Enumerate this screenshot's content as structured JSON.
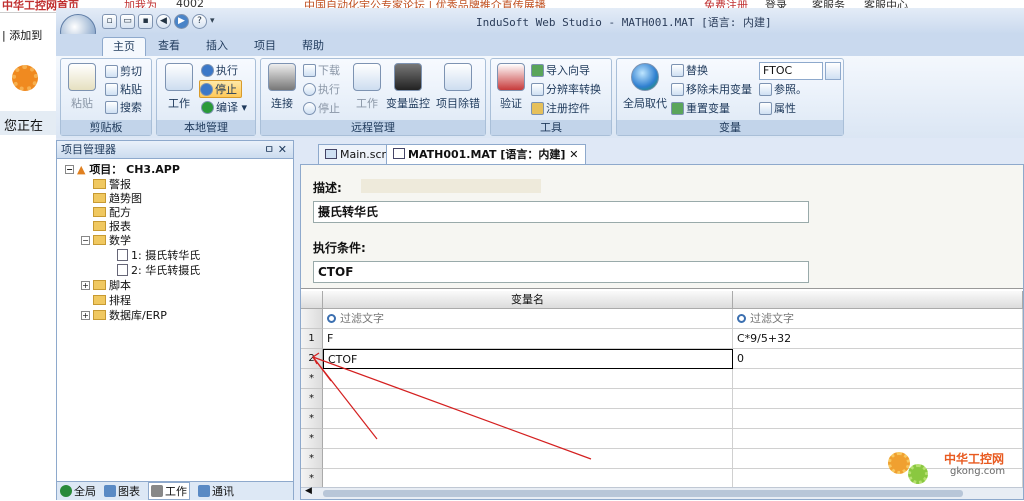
{
  "background": {
    "strip_texts": [
      "中华工控网首页",
      "加我为",
      "4002",
      "中国自动化宇公专家论坛 | 优秀品牌推介直传展播",
      "免费注册",
      "登录",
      "客服务",
      "客服中心"
    ],
    "left_texts": [
      "| 添加到",
      "您正在"
    ]
  },
  "window": {
    "title": "InduSoft Web Studio - MATH001.MAT [语言: 内建]",
    "quick_access": [
      "new",
      "open",
      "save",
      "back",
      "forward",
      "help"
    ]
  },
  "ribbon": {
    "tabs": [
      "主页",
      "查看",
      "插入",
      "项目",
      "帮助"
    ],
    "active_tab": "主页",
    "groups": {
      "clipboard": {
        "caption": "剪贴板",
        "paste": "粘贴",
        "cut": "剪切",
        "paste2": "粘贴",
        "search": "搜索"
      },
      "local": {
        "caption": "本地管理",
        "work": "工作",
        "run": "执行",
        "stop": "停止",
        "compile": "编译"
      },
      "remote": {
        "caption": "远程管理",
        "connect": "连接",
        "download": "下载",
        "run": "执行",
        "stop": "停止",
        "work": "工作",
        "monitor": "变量监控",
        "debug": "项目除错"
      },
      "tools": {
        "caption": "工具",
        "verify": "验证",
        "import": "导入向导",
        "resolution": "分辨率转换",
        "register": "注册控件"
      },
      "tags": {
        "caption": "变量",
        "global_replace": "全局取代",
        "replace": "替换",
        "remove_unused": "移除未用变量",
        "reset": "重置变量",
        "search_value": "FTOC",
        "refs": "参照。",
        "props": "属性"
      }
    }
  },
  "project_manager": {
    "title": "项目管理器",
    "controls": "ㅁ ✕",
    "root": "项目： CH3.APP",
    "items": [
      "警报",
      "趋势图",
      "配方",
      "报表",
      "数学",
      "1: 摄氏转华氏",
      "2: 华氏转摄氏",
      "脚本",
      "排程",
      "数据库/ERP"
    ],
    "footer_tabs": [
      "全局",
      "图表",
      "工作",
      "通讯"
    ]
  },
  "doc_tabs": {
    "tab1": "Main.scr",
    "tab2": "MATH001.MAT [语言：内建]",
    "close": "✕"
  },
  "form": {
    "desc_label": "描述:",
    "desc_value": "摄氏转华氏",
    "cond_label": "执行条件:",
    "cond_value": "CTOF"
  },
  "grid": {
    "col_tag": "变量名",
    "filter_placeholder": "过滤文字",
    "rows": [
      {
        "num": "1",
        "tag": "F",
        "expr": "C*9/5+32"
      },
      {
        "num": "2",
        "tag": "CTOF",
        "expr": "0"
      }
    ],
    "new_row_marker": "*"
  },
  "watermark": {
    "name": "中华工控网",
    "url": "gkong.com"
  },
  "colors": {
    "ribbon_bg": "#dbe6f4",
    "accent": "#1e395b",
    "annotation": "#d42020"
  }
}
